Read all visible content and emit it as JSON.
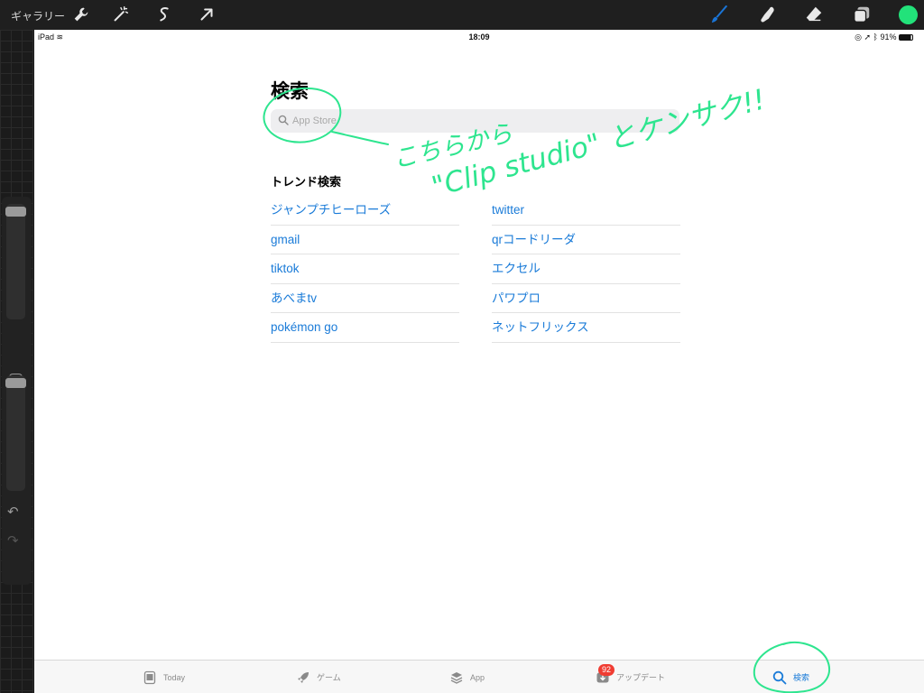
{
  "toolbar": {
    "gallery_label": "ギャラリー",
    "left_icons": [
      "wrench-icon",
      "magic-wand-icon",
      "selection-icon",
      "transform-arrow-icon"
    ],
    "right_icons": [
      "brush-icon",
      "smudge-icon",
      "eraser-icon",
      "layers-icon"
    ],
    "brush_color": "#1a74d6",
    "current_color": "#22e27a"
  },
  "statusbar": {
    "device": "iPad",
    "time": "18:09",
    "battery": "91%"
  },
  "appstore": {
    "title": "検索",
    "search_placeholder": "App Store",
    "trend_title": "トレンド検索",
    "trends_left": [
      "ジャンプチヒーローズ",
      "gmail",
      "tiktok",
      "あべまtv",
      "pokémon go"
    ],
    "trends_right": [
      "twitter",
      "qrコードリーダ",
      "エクセル",
      "パワプロ",
      "ネットフリックス"
    ],
    "link_color": "#1a7bd8"
  },
  "tabs": [
    {
      "label": "Today",
      "icon": "today-icon"
    },
    {
      "label": "ゲーム",
      "icon": "rocket-icon"
    },
    {
      "label": "App",
      "icon": "app-stack-icon"
    },
    {
      "label": "アップデート",
      "icon": "download-icon",
      "badge": "92"
    },
    {
      "label": "検索",
      "icon": "search-icon",
      "active": true
    }
  ],
  "annotation": {
    "color": "#2ee58f",
    "line1": "こちらから",
    "line2": "\"Clip studio\" とケンサク!!"
  }
}
